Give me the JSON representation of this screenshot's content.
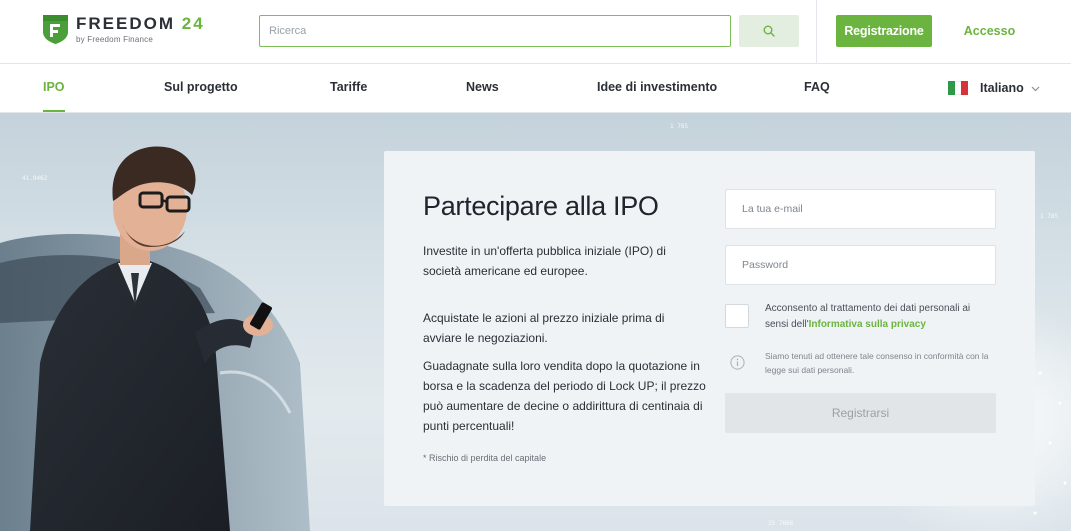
{
  "brand": {
    "name": "FREEDOM",
    "number": "24",
    "tagline": "by Freedom Finance",
    "accent_color": "#6bb43f"
  },
  "header": {
    "search_placeholder": "Ricerca",
    "search_icon": "search-icon",
    "register_label": "Registrazione",
    "login_label": "Accesso"
  },
  "nav": {
    "items": [
      {
        "label": "IPO",
        "active": true
      },
      {
        "label": "Sul progetto"
      },
      {
        "label": "Tariffe"
      },
      {
        "label": "News"
      },
      {
        "label": "Idee di investimento"
      },
      {
        "label": "FAQ"
      }
    ],
    "language": {
      "label": "Italiano",
      "flag_icon": "italy-flag-icon",
      "flag_colors": [
        "#2e9a48",
        "#ffffff",
        "#d8323b"
      ]
    }
  },
  "hero": {
    "tickers": [
      "1 785",
      "41.9462",
      "1 785",
      "25 7668"
    ],
    "form": {
      "title": "Partecipare alla IPO",
      "paragraph1": "Investite in un'offerta pubblica iniziale (IPO) di società americane ed europee.",
      "paragraph2": "Acquistate le azioni al prezzo iniziale prima di avviare le negoziazioni.",
      "paragraph3": "Guadagnate sulla loro vendita dopo la quotazione in borsa e la scadenza del periodo di Lock UP; il prezzo può aumentare de decine o addirittura di centinaia di punti percentuali!",
      "footnote": "* Rischio di perdita del capitale",
      "email_placeholder": "La tua e-mail",
      "password_placeholder": "Password",
      "consent_text": "Acconsento al trattamento dei dati personali ai sensi dell'",
      "consent_link": "Informativa sulla privacy",
      "info_text": "Siamo tenuti ad ottenere tale consenso in conformità con la legge sui dati personali.",
      "submit_label": "Registrarsi"
    }
  }
}
